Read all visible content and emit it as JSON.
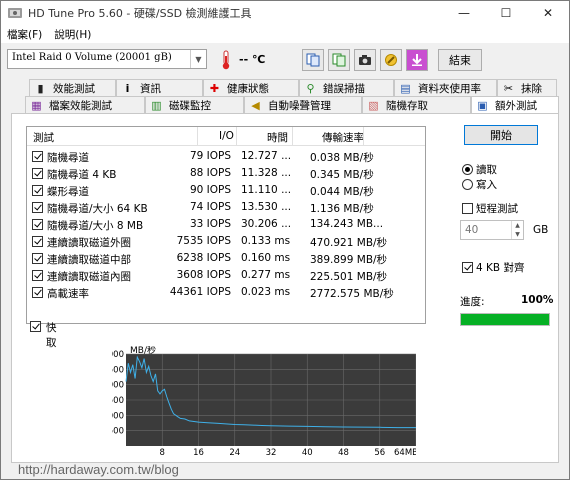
{
  "window": {
    "title": "HD Tune Pro 5.60 - 硬碟/SSD 檢測維護工具",
    "controls": [
      "—",
      "☐",
      "✕"
    ]
  },
  "menu": [
    "檔案(F)",
    "說明(H)"
  ],
  "toolbar": {
    "drive": "Intel  Raid 0 Volume (20001 gB)",
    "temperature": "-- ℃",
    "exit_label": "結束"
  },
  "tabs_row1": [
    "效能測試",
    "資訊",
    "健康狀態",
    "錯誤掃描",
    "資料夾使用率",
    "抹除"
  ],
  "tabs_row2": [
    "檔案效能測試",
    "磁碟監控",
    "自動噪聲管理",
    "隨機存取",
    "額外測試"
  ],
  "active_tab": "額外測試",
  "results": {
    "headers": [
      "測試",
      "I/O",
      "時間",
      "傳輸速率"
    ],
    "rows": [
      {
        "name": "隨機尋道",
        "io": "79 IOPS",
        "time": "12.727 ...",
        "rate": "0.038 MB/秒"
      },
      {
        "name": "隨機尋道 4 KB",
        "io": "88 IOPS",
        "time": "11.328 ...",
        "rate": "0.345 MB/秒"
      },
      {
        "name": "蝶形尋道",
        "io": "90 IOPS",
        "time": "11.110 ...",
        "rate": "0.044 MB/秒"
      },
      {
        "name": "隨機尋道/大小 64 KB",
        "io": "74 IOPS",
        "time": "13.530 ...",
        "rate": "1.136 MB/秒"
      },
      {
        "name": "隨機尋道/大小 8 MB",
        "io": "33 IOPS",
        "time": "30.206 ...",
        "rate": "134.243 MB..."
      },
      {
        "name": "連續讀取磁道外圈",
        "io": "7535 IOPS",
        "time": "0.133 ms",
        "rate": "470.921 MB/秒"
      },
      {
        "name": "連續讀取磁道中部",
        "io": "6238 IOPS",
        "time": "0.160 ms",
        "rate": "389.899 MB/秒"
      },
      {
        "name": "連續讀取磁道內圈",
        "io": "3608 IOPS",
        "time": "0.277 ms",
        "rate": "225.501 MB/秒"
      },
      {
        "name": "高載速率",
        "io": "44361 IOPS",
        "time": "0.023 ms",
        "rate": "2772.575 MB/秒"
      }
    ]
  },
  "quick_label": "快取",
  "controls": {
    "start": "開始",
    "read": "讀取",
    "write": "寫入",
    "short_test": "短程測試",
    "size_value": "40",
    "size_unit": "GB",
    "align": "4 KB 對齊",
    "progress_label": "進度:",
    "progress_value": "100%",
    "progress_fraction": 1.0
  },
  "chart_data": {
    "type": "line",
    "ylabel": "MB/秒",
    "xlabel": "MB",
    "x_ticks": [
      "8",
      "16",
      "24",
      "32",
      "40",
      "48",
      "56",
      "64MB"
    ],
    "y_ticks": [
      "3000",
      "2500",
      "2000",
      "1500",
      "1000",
      "500"
    ],
    "xlim": [
      0,
      64
    ],
    "ylim": [
      0,
      3000
    ],
    "series": [
      {
        "x": [
          0,
          0.5,
          1,
          1.5,
          2,
          2.5,
          3,
          3.5,
          4,
          4.5,
          5,
          5.5,
          6,
          6.5,
          7,
          7.5,
          8,
          8.5,
          9,
          9.5,
          10,
          10.5,
          11,
          11.5,
          12,
          13,
          14,
          16,
          18,
          20,
          22,
          24,
          26,
          28,
          30,
          32,
          36,
          40,
          44,
          48,
          52,
          56,
          60,
          64
        ],
        "y": [
          2100,
          2700,
          2400,
          2650,
          2200,
          2900,
          2750,
          2550,
          2850,
          2400,
          2600,
          2300,
          2100,
          2350,
          1800,
          1700,
          1800,
          1850,
          1600,
          1400,
          1200,
          1050,
          1000,
          950,
          900,
          880,
          820,
          780,
          760,
          740,
          720,
          700,
          690,
          680,
          670,
          660,
          650,
          640,
          630,
          620,
          615,
          610,
          600,
          600
        ]
      }
    ]
  },
  "watermark": "http://hardaway.com.tw/blog"
}
